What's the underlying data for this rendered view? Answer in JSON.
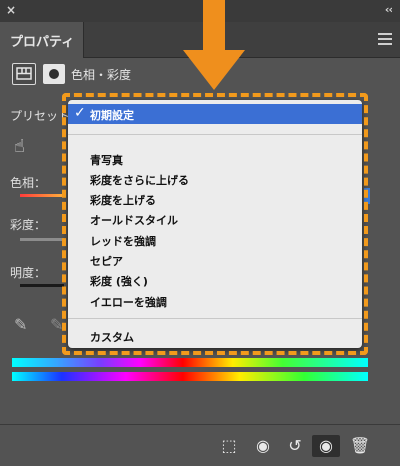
{
  "topbar": {
    "close_glyph": "×",
    "collapse_glyph": "‹‹"
  },
  "tabs": [
    {
      "label": "プロパティ"
    }
  ],
  "header": {
    "title": "色相・彩度",
    "adjustment_icon": "adjustment-layer-icon",
    "mask_icon": "layer-mask-icon"
  },
  "labels": {
    "preset": "プリセット",
    "hue": "色相：",
    "saturation": "彩度：",
    "lightness": "明度："
  },
  "dropdown": {
    "selected": "初期設定",
    "items": [
      "青写真",
      "彩度をさらに上げる",
      "彩度を上げる",
      "オールドスタイル",
      "レッドを強調",
      "セピア",
      "彩度 (強く)",
      "イエローを強調"
    ],
    "custom": "カスタム"
  },
  "icons": {
    "target": "on-image-adjust-icon",
    "eyedropper": "eyedropper-icon",
    "eyedropper_plus": "eyedropper-add-icon",
    "clip": "clip-to-layer-icon",
    "previous": "view-previous-state-icon",
    "reset": "reset-icon",
    "visibility": "eye-icon",
    "delete": "trash-icon"
  },
  "colors": {
    "panel_bg": "#535353",
    "highlight": "#3b6fd4",
    "annotation": "#f29a1c"
  }
}
